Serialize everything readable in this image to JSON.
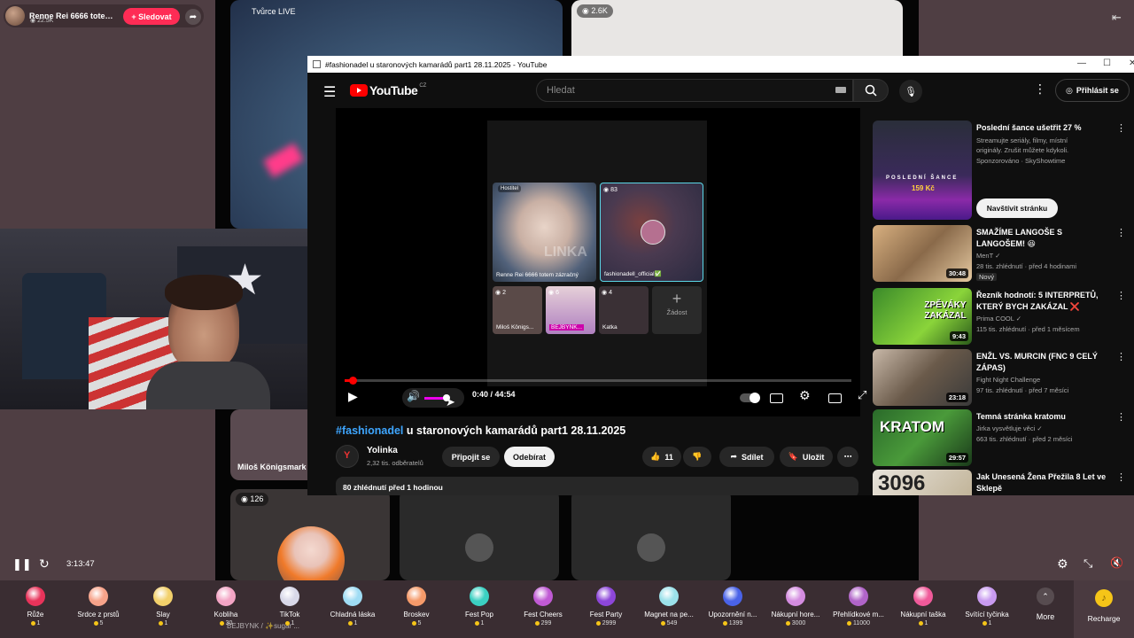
{
  "tiktok": {
    "host_name": "Renne Rei 6666 totem z...",
    "host_likes": "22.5K",
    "follow_label": "+ Sledovat",
    "tiles": {
      "top_left_label": "Tvůrce LIVE",
      "top_right_viewers": "2.6K",
      "mid_left_name": "Miloš Königsmark",
      "bottom_left_viewers": "126"
    },
    "chat_snippet": "BEJBYNK / ✨sugar ...",
    "playback_time": "3:13:47",
    "gifts": [
      {
        "name": "Růže",
        "price": "1",
        "color": "#e8335a"
      },
      {
        "name": "Srdce z prstů",
        "price": "5",
        "color": "#f7a38a"
      },
      {
        "name": "Slay",
        "price": "1",
        "color": "#f2d06b"
      },
      {
        "name": "Kobliha",
        "price": "30",
        "color": "#f3a4c4"
      },
      {
        "name": "TikTok",
        "price": "1",
        "color": "#d8d8e8"
      },
      {
        "name": "Chladná láska",
        "price": "1",
        "color": "#9fdcf4"
      },
      {
        "name": "Broskev",
        "price": "5",
        "color": "#f59a6a"
      },
      {
        "name": "Fest Pop",
        "price": "1",
        "color": "#3bd0c2"
      },
      {
        "name": "Fest Cheers",
        "price": "299",
        "color": "#c05ad4"
      },
      {
        "name": "Fest Party",
        "price": "2999",
        "color": "#8d46d9"
      },
      {
        "name": "Magnet na pe...",
        "price": "549",
        "color": "#9be1ea"
      },
      {
        "name": "Upozornění n...",
        "price": "1399",
        "color": "#4a63e8"
      },
      {
        "name": "Nákupní hore...",
        "price": "3000",
        "color": "#d48ce0"
      },
      {
        "name": "Přehlídkové m...",
        "price": "11000",
        "color": "#b064c8"
      },
      {
        "name": "Nákupní taška",
        "price": "1",
        "color": "#f05a9a"
      },
      {
        "name": "Svítící tyčinka",
        "price": "1",
        "color": "#c89af0"
      }
    ],
    "more_label": "More",
    "recharge_label": "Recharge"
  },
  "youtube": {
    "window_title": "#fashionadel u staronových kamarádů part1 28.11.2025 - YouTube",
    "logo_text": "YouTube",
    "logo_region": "CZ",
    "search_placeholder": "Hledat",
    "signin_label": "Přihlásit se",
    "time_current": "0:40",
    "time_sep": " / ",
    "time_total": "44:54",
    "progress_fraction": 0.015,
    "video_inner": {
      "host_label": "Hostitel",
      "right_viewers": "83",
      "host_caption": "Renne Rei 6666 totem zázračný",
      "right_caption": "fashionadell_official✅",
      "watermark": "LINKA",
      "small": [
        {
          "count": "2",
          "name": "Miloš Königs..."
        },
        {
          "count": "6",
          "name": "BEJBYNK..."
        },
        {
          "count": "4",
          "name": "Katka"
        }
      ],
      "request_label": "Žádost"
    },
    "video_title_tag": "#fashionadel",
    "video_title_rest": " u staronových kamarádů part1 28.11.2025",
    "channel_name": "Yolinka",
    "channel_subs": "2,32 tis. odběratelů",
    "join_label": "Připojit se",
    "subscribe_label": "Odebírat",
    "likes": "11",
    "share_label": "Sdílet",
    "save_label": "Uložit",
    "desc_line": "80 zhlédnutí  před 1 hodinou",
    "recommendations": [
      {
        "title": "Poslední šance ušetřit 27 %",
        "line1": "Streamujte seriály, filmy, místní originály. Zrušit můžete kdykoli.",
        "line2": "Sponzorováno · SkyShowtime",
        "cta": "Navštívit stránku",
        "thumb_text": "POSLEDNÍ ŠANCE",
        "thumb_price": "159 Kč"
      },
      {
        "title": "SMAŽÍME LANGOŠE S LANGOŠEM! 😆",
        "channel": "MenT",
        "meta": "28 tis. zhlédnutí · před 4 hodinami",
        "badge": "Nový",
        "duration": "30:48"
      },
      {
        "title": "Řezník hodnotí: 5 INTERPRETŮ, KTERÝ BYCH ZAKÁZAL ❌",
        "channel": "Prima COOL",
        "meta": "115 tis. zhlédnutí · před 1 měsícem",
        "duration": "9:43",
        "thumb_text": "ZPĚVÁKY ZAKÁZAL"
      },
      {
        "title": "ENŽL VS. MURCIN (FNC 9 CELÝ ZÁPAS)",
        "channel": "Fight Night Challenge",
        "meta": "97 tis. zhlédnutí · před 7 měsíci",
        "duration": "23:18"
      },
      {
        "title": "Temná stránka kratomu",
        "channel": "Jirka vysvětluje věci",
        "meta": "663 tis. zhlédnutí · před 2 měsíci",
        "duration": "29:57",
        "thumb_text": "KRATOM"
      },
      {
        "title": "Jak Unesená Žena Přežila 8 Let ve Sklepě",
        "thumb_text": "3096"
      }
    ]
  }
}
